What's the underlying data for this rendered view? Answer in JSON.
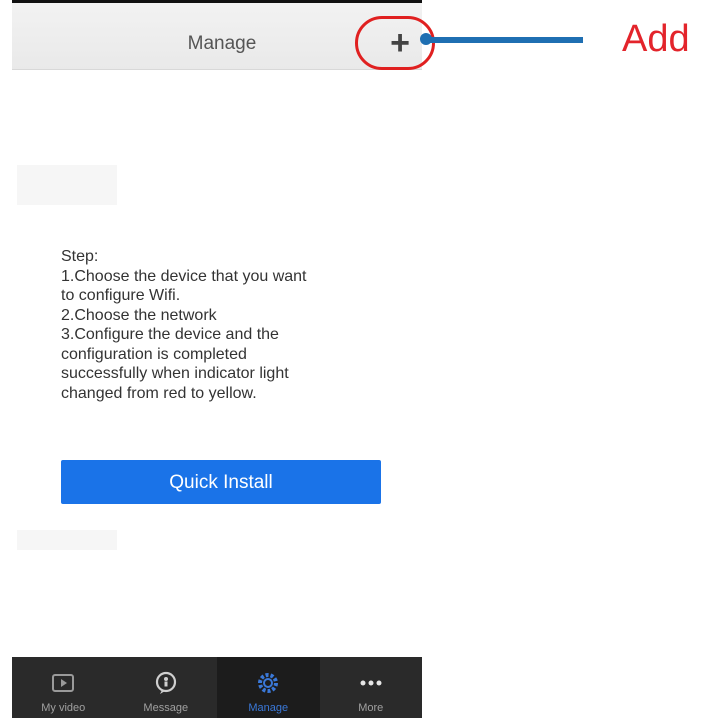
{
  "header": {
    "title": "Manage",
    "add_symbol": "+"
  },
  "callout": {
    "label": "Add"
  },
  "steps": {
    "lines": [
      "Step:",
      "1.Choose the device that you want",
      "to configure Wifi.",
      "2.Choose the network",
      "3.Configure the device and the",
      "configuration is completed",
      "successfully when indicator light",
      "changed from red to yellow."
    ]
  },
  "quick_install": {
    "label": "Quick Install"
  },
  "tabs": [
    {
      "label": "My video",
      "icon": "video-icon"
    },
    {
      "label": "Message",
      "icon": "message-icon"
    },
    {
      "label": "Manage",
      "icon": "gear-icon",
      "active": true
    },
    {
      "label": "More",
      "icon": "more-icon"
    }
  ],
  "colors": {
    "accent": "#1a73e8",
    "callout": "#e3242b",
    "pointer": "#1f6fb2",
    "tabbar": "#2a2a2a"
  }
}
